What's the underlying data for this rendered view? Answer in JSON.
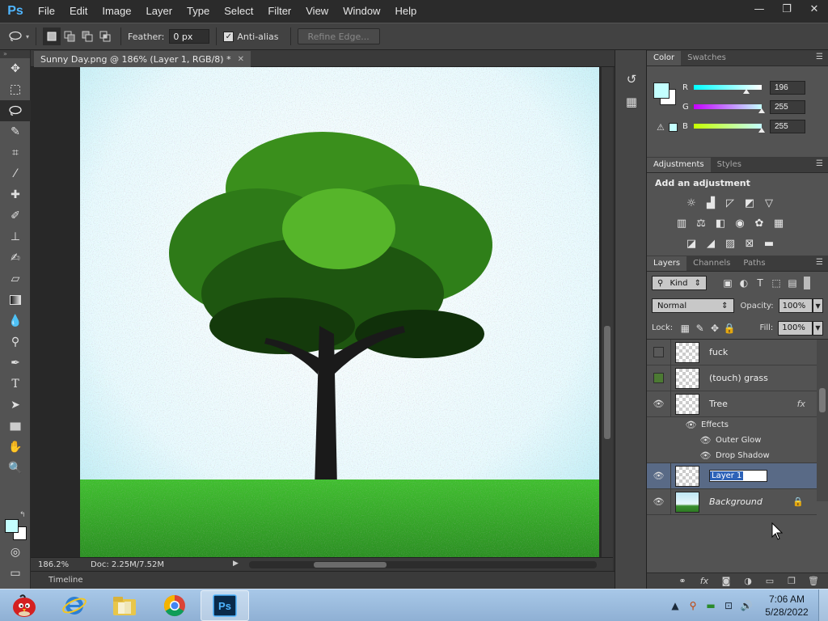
{
  "app": {
    "logo": "Ps",
    "menu": [
      "File",
      "Edit",
      "Image",
      "Layer",
      "Type",
      "Select",
      "Filter",
      "View",
      "Window",
      "Help"
    ],
    "window_controls": [
      "—",
      "❐",
      "✕"
    ]
  },
  "options": {
    "feather_label": "Feather:",
    "feather_value": "0 px",
    "antialias_label": "Anti-alias",
    "antialias_checked": true,
    "refine_edge_label": "Refine Edge..."
  },
  "document": {
    "tab_title": "Sunny Day.png @ 186% (Layer 1, RGB/8) *",
    "zoom": "186.2%",
    "doc_info": "Doc: 2.25M/7.52M",
    "timeline_label": "Timeline"
  },
  "colors": {
    "foreground": "#c4ffff",
    "background": "#ffffff",
    "accent_selection": "#596a86"
  },
  "color_panel": {
    "tabs": [
      "Color",
      "Swatches"
    ],
    "channels": [
      {
        "label": "R",
        "value": "196",
        "level": 0.77,
        "gradient": "linear-gradient(to right, #00ffff, #ffffff)"
      },
      {
        "label": "G",
        "value": "255",
        "level": 1.0,
        "gradient": "linear-gradient(to right, #c400ff, #c4ffff)"
      },
      {
        "label": "B",
        "value": "255",
        "level": 1.0,
        "gradient": "linear-gradient(to right, #c4ff00, #c4ffff)"
      }
    ]
  },
  "adjustments_panel": {
    "tabs": [
      "Adjustments",
      "Styles"
    ],
    "title": "Add an adjustment"
  },
  "layers_panel": {
    "tabs": [
      "Layers",
      "Channels",
      "Paths"
    ],
    "filter_kind": "Kind",
    "blend_mode": "Normal",
    "opacity_label": "Opacity:",
    "opacity_value": "100%",
    "lock_label": "Lock:",
    "fill_label": "Fill:",
    "fill_value": "100%",
    "layers": [
      {
        "name": "fuck",
        "visible": false
      },
      {
        "name": "(touch) grass",
        "visible": false
      },
      {
        "name": "Tree",
        "visible": true,
        "fx": "fx",
        "effects_label": "Effects",
        "effects": [
          "Outer Glow",
          "Drop Shadow"
        ]
      },
      {
        "name": "Layer 1",
        "visible": true,
        "selected": true,
        "renaming": true
      },
      {
        "name": "Background",
        "visible": true,
        "locked": true
      }
    ]
  },
  "taskbar": {
    "apps": [
      "angry-birds",
      "internet-explorer",
      "file-explorer",
      "chrome",
      "photoshop"
    ],
    "active_app": "photoshop",
    "time": "7:06 AM",
    "date": "5/28/2022"
  }
}
